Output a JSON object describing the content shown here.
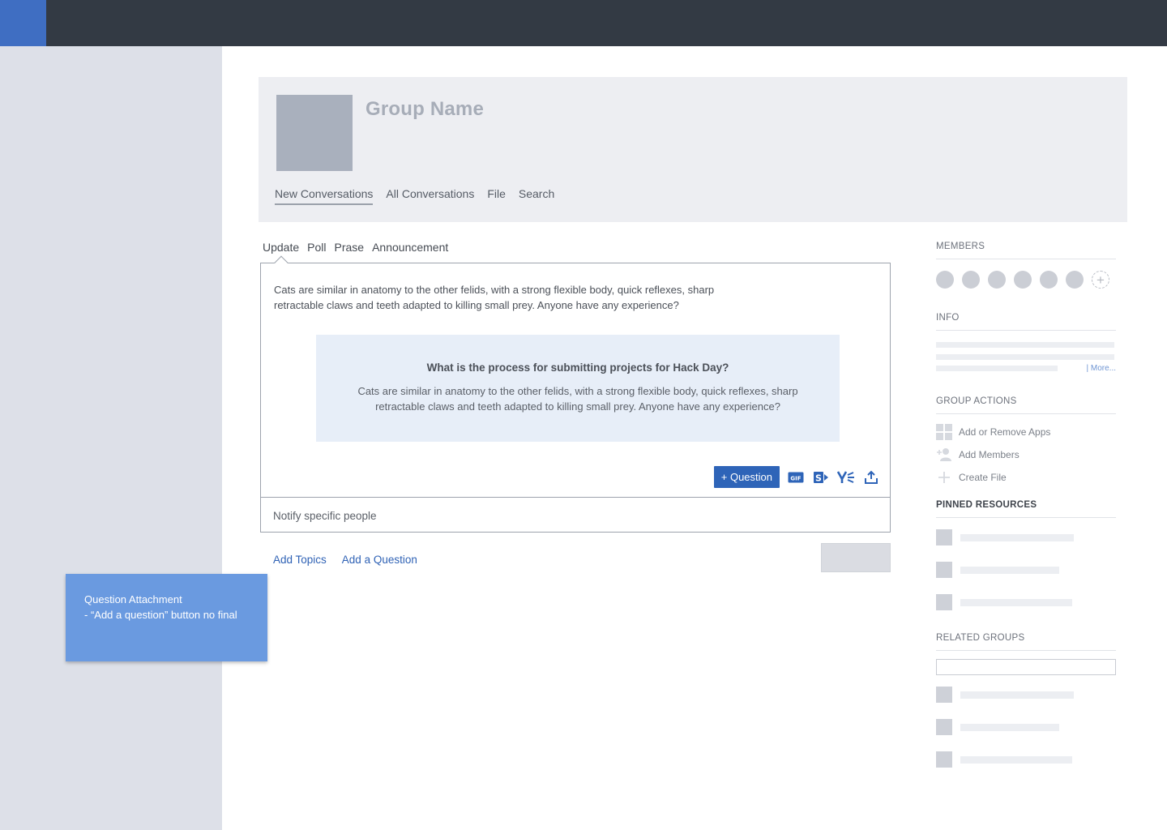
{
  "group": {
    "name": "Group Name",
    "tabs": [
      {
        "label": "New Conversations"
      },
      {
        "label": "All Conversations"
      },
      {
        "label": "File"
      },
      {
        "label": "Search"
      }
    ]
  },
  "publisher": {
    "tabs": [
      {
        "label": "Update"
      },
      {
        "label": "Poll"
      },
      {
        "label": "Prase"
      },
      {
        "label": "Announcement"
      }
    ],
    "body_line1": "Cats are similar in anatomy to the other felids, with a strong flexible body, quick reflexes, sharp",
    "body_line2": "retractable claws and teeth adapted to killing small prey.  Anyone have any experience?",
    "question_card": {
      "title": "What is the process for submitting projects for Hack Day?",
      "body_line1": "Cats are similar in anatomy to the other felids, with a strong flexible body, quick reflexes, sharp",
      "body_line2": "retractable claws and teeth adapted to killing small prey.  Anyone have any experience?"
    },
    "question_button": "+ Question",
    "toolbar_icons": [
      "gif-icon",
      "sharepoint-icon",
      "yammer-icon",
      "upload-icon"
    ],
    "notify_placeholder": "Notify specific people",
    "links": {
      "add_topics": "Add Topics",
      "add_question": "Add a Question"
    }
  },
  "annotation": {
    "line1": "Question Attachment",
    "line2": "- “Add a question” button no final"
  },
  "sidebar": {
    "members_title": "MEMBERS",
    "member_count_shown": 6,
    "info_title": "INFO",
    "more_link": "| More...",
    "group_actions_title": "GROUP ACTIONS",
    "actions": [
      {
        "label": "Add or Remove Apps",
        "icon": "apps-grid-icon"
      },
      {
        "label": "Add Members",
        "icon": "add-member-icon"
      },
      {
        "label": "Create File",
        "icon": "plus-icon"
      }
    ],
    "pinned_title": "PINNED RESOURCES",
    "related_title": "RELATED GROUPS"
  },
  "colors": {
    "topbar": "#333a44",
    "brand": "#3f6ec2",
    "accent": "#2e64b8",
    "annotation": "#6a9ae0"
  }
}
